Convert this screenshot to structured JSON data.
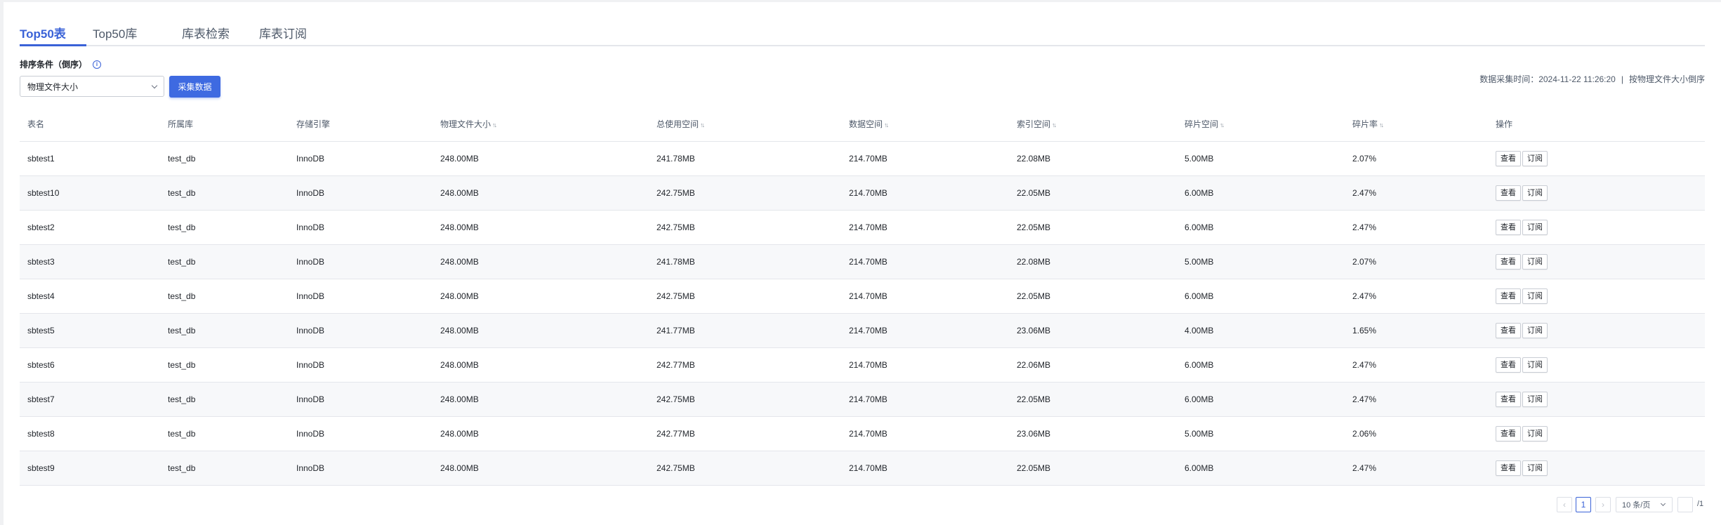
{
  "tabs": [
    {
      "label": "Top50表",
      "active": true
    },
    {
      "label": "Top50库",
      "active": false
    },
    {
      "label": "库表检索",
      "active": false
    },
    {
      "label": "库表订阅",
      "active": false
    }
  ],
  "sort": {
    "label": "排序条件（倒序）",
    "info_icon": "info-circle-icon",
    "selected": "物理文件大小"
  },
  "collect_button": "采集数据",
  "meta": {
    "collect_time": "数据采集时间：2024-11-22 11:26:20",
    "separator": "|",
    "order_desc": "按物理文件大小倒序"
  },
  "table": {
    "columns": [
      "表名",
      "所属库",
      "存储引擎",
      "物理文件大小",
      "总使用空间",
      "数据空间",
      "索引空间",
      "碎片空间",
      "碎片率",
      "操作"
    ],
    "sortable_columns": [
      "物理文件大小",
      "总使用空间",
      "数据空间",
      "索引空间",
      "碎片空间",
      "碎片率"
    ],
    "rows": [
      [
        "sbtest1",
        "test_db",
        "InnoDB",
        "248.00MB",
        "241.78MB",
        "214.70MB",
        "22.08MB",
        "5.00MB",
        "2.07%"
      ],
      [
        "sbtest10",
        "test_db",
        "InnoDB",
        "248.00MB",
        "242.75MB",
        "214.70MB",
        "22.05MB",
        "6.00MB",
        "2.47%"
      ],
      [
        "sbtest2",
        "test_db",
        "InnoDB",
        "248.00MB",
        "242.75MB",
        "214.70MB",
        "22.05MB",
        "6.00MB",
        "2.47%"
      ],
      [
        "sbtest3",
        "test_db",
        "InnoDB",
        "248.00MB",
        "241.78MB",
        "214.70MB",
        "22.08MB",
        "5.00MB",
        "2.07%"
      ],
      [
        "sbtest4",
        "test_db",
        "InnoDB",
        "248.00MB",
        "242.75MB",
        "214.70MB",
        "22.05MB",
        "6.00MB",
        "2.47%"
      ],
      [
        "sbtest5",
        "test_db",
        "InnoDB",
        "248.00MB",
        "241.77MB",
        "214.70MB",
        "23.06MB",
        "4.00MB",
        "1.65%"
      ],
      [
        "sbtest6",
        "test_db",
        "InnoDB",
        "248.00MB",
        "242.77MB",
        "214.70MB",
        "22.06MB",
        "6.00MB",
        "2.47%"
      ],
      [
        "sbtest7",
        "test_db",
        "InnoDB",
        "248.00MB",
        "242.75MB",
        "214.70MB",
        "22.05MB",
        "6.00MB",
        "2.47%"
      ],
      [
        "sbtest8",
        "test_db",
        "InnoDB",
        "248.00MB",
        "242.77MB",
        "214.70MB",
        "23.06MB",
        "5.00MB",
        "2.06%"
      ],
      [
        "sbtest9",
        "test_db",
        "InnoDB",
        "248.00MB",
        "242.75MB",
        "214.70MB",
        "22.05MB",
        "6.00MB",
        "2.47%"
      ]
    ],
    "actions": [
      "查看",
      "订阅"
    ]
  },
  "pagination": {
    "prev_icon": "chevron-left-icon",
    "current_page": "1",
    "next_icon": "chevron-right-icon",
    "page_size": "10 条/页",
    "total_pages": "/1"
  },
  "colors": {
    "accent": "#3a62d7",
    "button": "#3e6ae1",
    "stripe": "#f7f8fa"
  }
}
